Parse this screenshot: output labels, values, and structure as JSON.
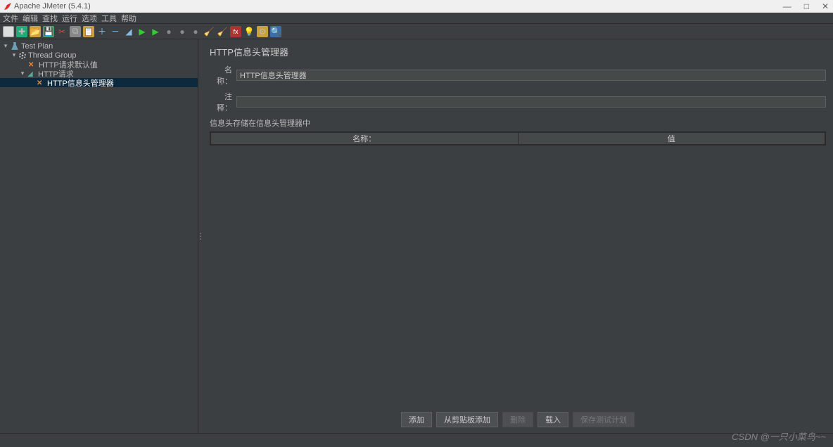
{
  "window": {
    "title": "Apache JMeter (5.4.1)"
  },
  "menu": {
    "items": [
      "文件",
      "编辑",
      "查找",
      "运行",
      "选项",
      "工具",
      "帮助"
    ]
  },
  "toolbar_icons": [
    "new",
    "templates",
    "open",
    "save",
    "cut",
    "copy",
    "paste",
    "collapse",
    "expand",
    "toggle",
    "clear",
    "clear-all",
    "start",
    "start-no-timers",
    "stop",
    "shutdown",
    "remote-start",
    "remote-stop",
    "func-helper",
    "help-icon",
    "search-reset",
    "search"
  ],
  "tree": {
    "root": "Test Plan",
    "group": "Thread Group",
    "defaults": "HTTP请求默认值",
    "request": "HTTP请求",
    "header_mgr": "HTTP信息头管理器"
  },
  "panel": {
    "title": "HTTP信息头管理器",
    "name_label": "名称：",
    "name_value": "HTTP信息头管理器",
    "comment_label": "注释：",
    "comment_value": "",
    "section": "信息头存储在信息头管理器中",
    "col_name": "名称：",
    "col_value": "值"
  },
  "buttons": {
    "add": "添加",
    "add_clipboard": "从剪贴板添加",
    "delete": "删除",
    "load": "载入",
    "save": "保存测试计划"
  },
  "watermark": "CSDN @一只小菜鸟~~"
}
